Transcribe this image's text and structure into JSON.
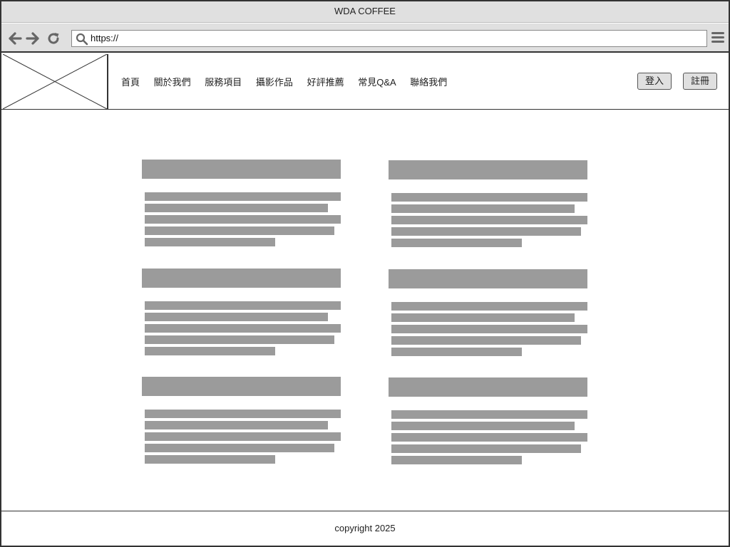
{
  "window": {
    "title": "WDA COFFEE"
  },
  "browser": {
    "url": "https://",
    "back_icon": "arrow-left-icon",
    "forward_icon": "arrow-right-icon",
    "reload_icon": "reload-icon",
    "search_icon": "search-icon",
    "menu_icon": "hamburger-menu-icon"
  },
  "header": {
    "logo": "image-placeholder-icon",
    "nav": [
      {
        "label": "首頁"
      },
      {
        "label": "關於我們"
      },
      {
        "label": "服務項目"
      },
      {
        "label": "攝影作品"
      },
      {
        "label": "好評推薦"
      },
      {
        "label": "常見Q&A"
      },
      {
        "label": "聯絡我們"
      }
    ],
    "login_label": "登入",
    "register_label": "註冊"
  },
  "content": {
    "card_count": 6,
    "placeholder_color": "#9b9b9b"
  },
  "footer": {
    "text": "copyright 2025"
  }
}
